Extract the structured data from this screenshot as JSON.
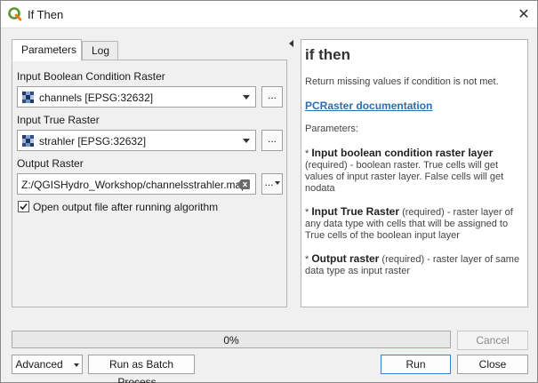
{
  "window": {
    "title": "If Then"
  },
  "tabs": [
    {
      "label": "Parameters",
      "active": true
    },
    {
      "label": "Log",
      "active": false
    }
  ],
  "params": {
    "cond_label": "Input Boolean Condition Raster",
    "cond_value": "channels [EPSG:32632]",
    "true_label": "Input True Raster",
    "true_value": "strahler [EPSG:32632]",
    "output_label": "Output Raster",
    "output_value": "Z:/QGISHydro_Workshop/channelsstrahler.map",
    "browse_label": "...",
    "open_after_label": "Open output file after running algorithm",
    "open_after_checked": true
  },
  "help": {
    "title": "if then",
    "summary": "Return missing values if condition is not met.",
    "doc_link": "PCRaster documentation",
    "params_heading": "Parameters:",
    "p1_name": "Input boolean condition raster layer",
    "p1_desc": "(required) - boolean raster. True cells will get values of input raster layer. False cells will get nodata",
    "p2_name": "Input True Raster",
    "p2_desc": "(required) - raster layer of any data type with cells that will be assigned to True cells of the boolean input layer",
    "p3_name": "Output raster",
    "p3_desc": "(required) - raster layer of same data type as input raster",
    "bullet": "*"
  },
  "progress": {
    "text": "0%",
    "value": 0
  },
  "buttons": {
    "cancel": "Cancel",
    "advanced": "Advanced",
    "batch": "Run as Batch Process...",
    "run": "Run",
    "close": "Close"
  },
  "colors": {
    "accent": "#3c7fd0",
    "link": "#2a6fb0",
    "qgis_green": "#589632"
  }
}
